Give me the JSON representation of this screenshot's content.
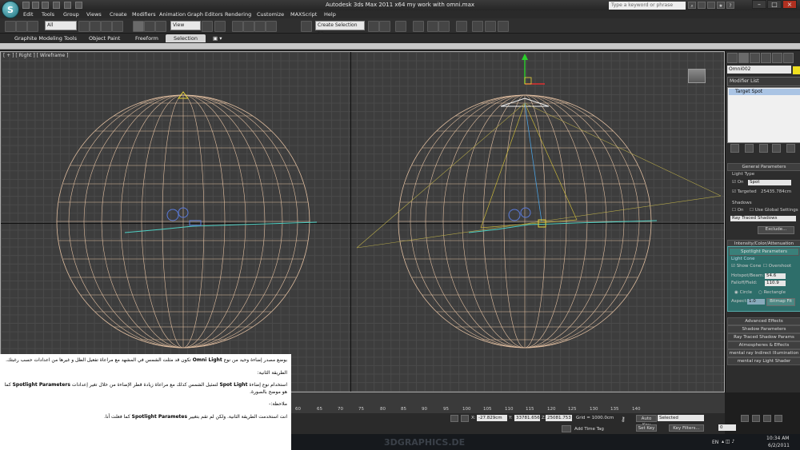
{
  "window": {
    "title": "Autodesk 3ds Max  2011 x64      my work with omni.max",
    "search_placeholder": "Type a keyword or phrase",
    "app_button_label": "S"
  },
  "menu": [
    "Edit",
    "Tools",
    "Group",
    "Views",
    "Create",
    "Modifiers",
    "Animation",
    "Graph Editors",
    "Rendering",
    "Customize",
    "MAXScript",
    "Help"
  ],
  "toolbar": {
    "filter_value": "All",
    "view_value": "View",
    "selection_set_value": "Create Selection Se"
  },
  "ribbon": {
    "tabs": [
      "Graphite Modeling Tools",
      "Object Paint",
      "Freeform",
      "Selection"
    ],
    "active": "Selection"
  },
  "viewport": {
    "label": "[ + ] [ Right ] [ Wireframe ]"
  },
  "command_panel": {
    "object_name": "Omni002",
    "modifier_list": "Modifier List",
    "stack_item": "Target Spot",
    "general_params": "General Parameters",
    "light_type_label": "Light Type",
    "on_label": "On",
    "type_value": "Spot",
    "targeted_label": "Targeted",
    "targeted_value": "25435.784cm",
    "shadows_label": "Shadows",
    "shadows_on_label": "On",
    "use_global_label": "Use Global Settings",
    "shadow_type": "Ray Traced Shadows",
    "exclude_label": "Exclude...",
    "intensity_rollout": "Intensity/Color/Attenuation",
    "spotlight_rollout": "Spotlight Parameters",
    "light_cone_label": "Light Cone",
    "show_cone_label": "Show Cone",
    "overshoot_label": "Overshoot",
    "hotspot_label": "Hotspot/Beam:",
    "hotspot_value": "54.6",
    "falloff_label": "Falloff/Field:",
    "falloff_value": "110.9",
    "circle_label": "Circle",
    "rectangle_label": "Rectangle",
    "aspect_label": "Aspect:",
    "aspect_value": "1.0",
    "bitmap_fit_label": "Bitmap Fit",
    "rollouts": [
      "Advanced Effects",
      "Shadow Parameters",
      "Ray Traced Shadow Params",
      "Atmospheres & Effects",
      "mental ray Indirect Illumination",
      "mental ray Light Shader"
    ]
  },
  "timeline": {
    "ticks": [
      "60",
      "65",
      "70",
      "75",
      "80",
      "85",
      "90",
      "95",
      "100",
      "105",
      "110",
      "115",
      "120",
      "125",
      "130",
      "135",
      "140"
    ]
  },
  "status": {
    "x_label": "X:",
    "x_value": "-27.829cm",
    "y_label": "Y:",
    "y_value": "33781.656",
    "z_label": "Z:",
    "z_value": "25081.753",
    "grid": "Grid = 1000.0cm",
    "add_time_tag": "Add Time Tag",
    "auto_key": "Auto Key",
    "set_key": "Set Key",
    "selected": "Selected",
    "key_filters": "Key Filters...",
    "frame_value": "0"
  },
  "taskbar": {
    "lang": "EN",
    "time": "10:34 AM",
    "date": "6/2/2011",
    "watermark": "3DGRAPHICS.DE"
  },
  "note": {
    "p1_a": "بوضع مصدر إضاءة وحيد من نوع ",
    "p1_b": "Omni Light",
    "p1_c": " تكون قد مثلت الشمس في المشهد مع مراعاة تفعيل الظل و غيرها من اعدادات حسب رغبتك.",
    "p2": "الطريقة الثانية:",
    "p3_a": "استخدام نوع إضاءة ",
    "p3_b": "Spot Light",
    "p3_c": " لتمثيل الشمس كذلك مع مراعاة زيادة قطر الإضاءة من خلال تغير إعدادات ",
    "p3_d": "Spotlight Parameters",
    "p3_e": " كما هو موضح بالصورة.",
    "p4": "ملاحظة:-",
    "p5_a": "انت استخدمت الطريقة الثانية. ولكن لم تقم بتغيير ",
    "p5_b": "Spotlight Parametes",
    "p5_c": " كما فعلت أنا."
  }
}
